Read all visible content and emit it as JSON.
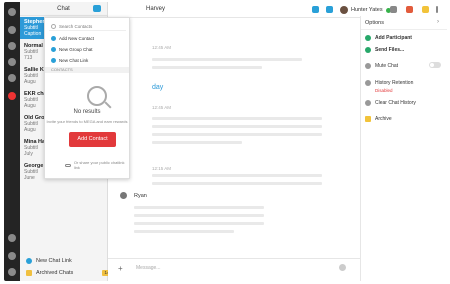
{
  "app": {
    "accent_color": "#2d9ad8",
    "danger_color": "#e2393b"
  },
  "chatlist": {
    "title": "Chat",
    "items": [
      {
        "name": "Stephen Tuc",
        "sub": "Subtitl",
        "sub2": "Caption",
        "selected": true
      },
      {
        "name": "Normal G",
        "sub": "Subtitl",
        "sub2": "713"
      },
      {
        "name": "Sallie Kee",
        "sub": "Subtitl",
        "sub2": "Augu"
      },
      {
        "name": "EKR chat",
        "sub": "Subtitl",
        "sub2": "Augu"
      },
      {
        "name": "Old Grou",
        "sub": "Subtitl",
        "sub2": "Augu"
      },
      {
        "name": "Mina Hal",
        "sub": "Subtitl",
        "sub2": "July"
      },
      {
        "name": "George M",
        "sub": "Subtitl",
        "sub2": "June"
      }
    ],
    "footer": {
      "new_chat_link": "New Chat Link",
      "archived_chats": "Archived Chats",
      "archived_count": "14"
    }
  },
  "conversation": {
    "title": "Harvey",
    "user_name": "Hunter Yates",
    "day_separator": "day",
    "timestamps": [
      "12:45 AM",
      "12:45 AM",
      "12:15 AM"
    ],
    "message_author": "Ryan",
    "composer_placeholder": "Message..."
  },
  "dropdown": {
    "search_placeholder": "Search Contacts",
    "actions": [
      "Add New Contact",
      "New Group Chat",
      "New Chat Link"
    ],
    "section_label": "CONTACTS",
    "no_results": "No results",
    "invite_text": "Invite your friends to MEGA and earn rewards",
    "add_contact_button": "Add Contact",
    "share_text": "Or share your public chatlink link"
  },
  "options": {
    "title": "Options",
    "add_participant": "Add Participant",
    "send_files": "Send Files...",
    "mute_chat": "Mute Chat",
    "history_retention": "History Retention",
    "history_retention_value": "Disabled",
    "clear_history": "Clear Chat History",
    "archive": "Archive"
  }
}
